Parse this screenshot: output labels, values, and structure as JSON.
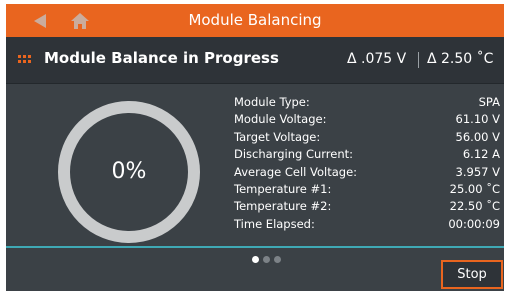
{
  "header": {
    "title": "Module Balancing",
    "back_icon": "back-arrow-icon",
    "home_icon": "home-icon"
  },
  "status": {
    "text": "Module Balance in Progress",
    "icon": "balance-status-icon",
    "delta_voltage": "Δ .075 V",
    "delta_temperature": "Δ 2.50 ˚C"
  },
  "progress": {
    "percent_label": "0%",
    "percent_value": 0
  },
  "details": [
    {
      "label": "Module Type:",
      "value": "SPA"
    },
    {
      "label": "Module Voltage:",
      "value": "61.10 V"
    },
    {
      "label": "Target Voltage:",
      "value": "56.00 V"
    },
    {
      "label": "Discharging Current:",
      "value": "6.12 A"
    },
    {
      "label": "Average Cell Voltage:",
      "value": "3.957 V"
    },
    {
      "label": "Temperature #1:",
      "value": "25.00 ˚C"
    },
    {
      "label": "Temperature #2:",
      "value": "22.50 ˚C"
    },
    {
      "label": "Time Elapsed:",
      "value": "00:00:09"
    }
  ],
  "pager": {
    "pages": 3,
    "active": 0
  },
  "actions": {
    "stop_label": "Stop"
  },
  "colors": {
    "accent": "#e9651f",
    "background": "#3b4146",
    "divider": "#3fa9b5"
  }
}
